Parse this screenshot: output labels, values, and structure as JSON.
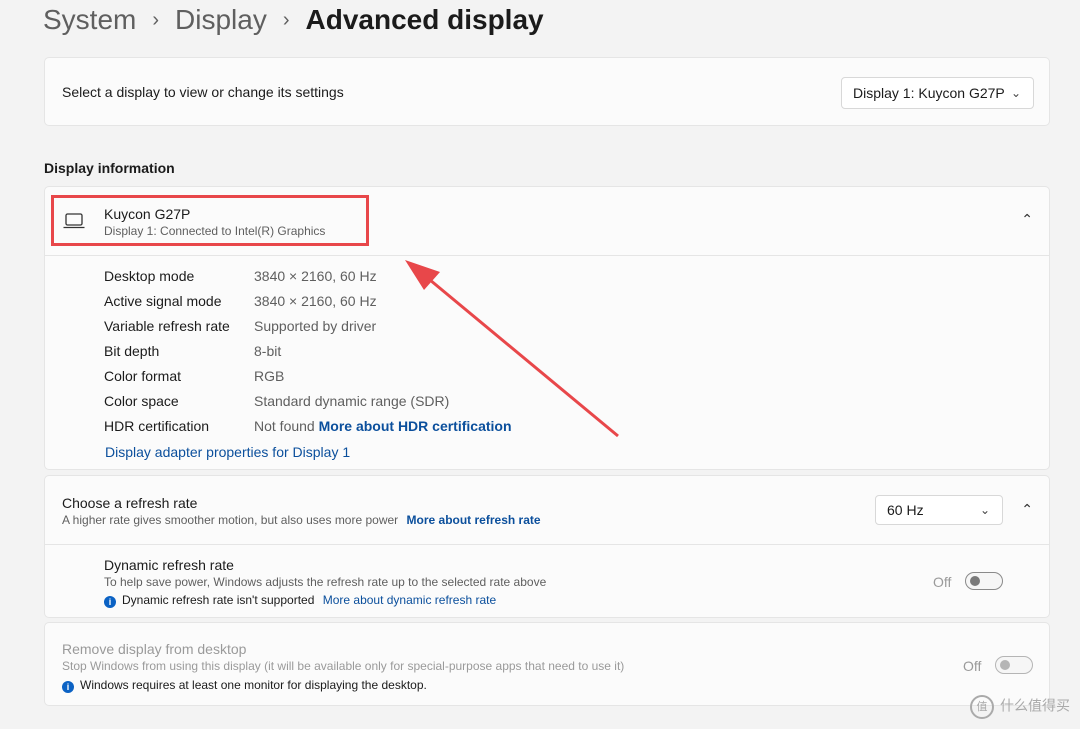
{
  "breadcrumb": {
    "items": [
      "System",
      "Display"
    ],
    "current": "Advanced display",
    "separator": "›"
  },
  "select_display": {
    "label": "Select a display to view or change its settings",
    "dropdown_value": "Display 1: Kuycon G27P"
  },
  "display_information": {
    "title": "Display information",
    "monitor_name": "Kuycon G27P",
    "monitor_desc": "Display 1: Connected to Intel(R) Graphics",
    "rows": [
      {
        "label": "Desktop mode",
        "value": "3840 × 2160, 60 Hz"
      },
      {
        "label": "Active signal mode",
        "value": "3840 × 2160, 60 Hz"
      },
      {
        "label": "Variable refresh rate",
        "value": "Supported by driver"
      },
      {
        "label": "Bit depth",
        "value": "8-bit"
      },
      {
        "label": "Color format",
        "value": "RGB"
      },
      {
        "label": "Color space",
        "value": "Standard dynamic range (SDR)"
      },
      {
        "label": "HDR certification",
        "value": "Not found",
        "link": "More about HDR certification"
      }
    ],
    "adapter_link": "Display adapter properties for Display 1"
  },
  "refresh_rate": {
    "title": "Choose a refresh rate",
    "desc": "A higher rate gives smoother motion, but also uses more power",
    "link": "More about refresh rate",
    "dropdown_value": "60 Hz"
  },
  "dynamic_refresh": {
    "title": "Dynamic refresh rate",
    "desc": "To help save power, Windows adjusts the refresh rate up to the selected rate above",
    "note": "Dynamic refresh rate isn't supported",
    "link": "More about dynamic refresh rate",
    "toggle_label": "Off"
  },
  "remove_display": {
    "title": "Remove display from desktop",
    "desc": "Stop Windows from using this display (it will be available only for special-purpose apps that need to use it)",
    "note": "Windows requires at least one monitor for displaying the desktop.",
    "toggle_label": "Off"
  },
  "watermark": {
    "text": "什么值得买",
    "logo_text": "值"
  },
  "colors": {
    "accent": "#0b4f9c",
    "annotation": "#e8474a",
    "background": "#f3f3f3"
  }
}
